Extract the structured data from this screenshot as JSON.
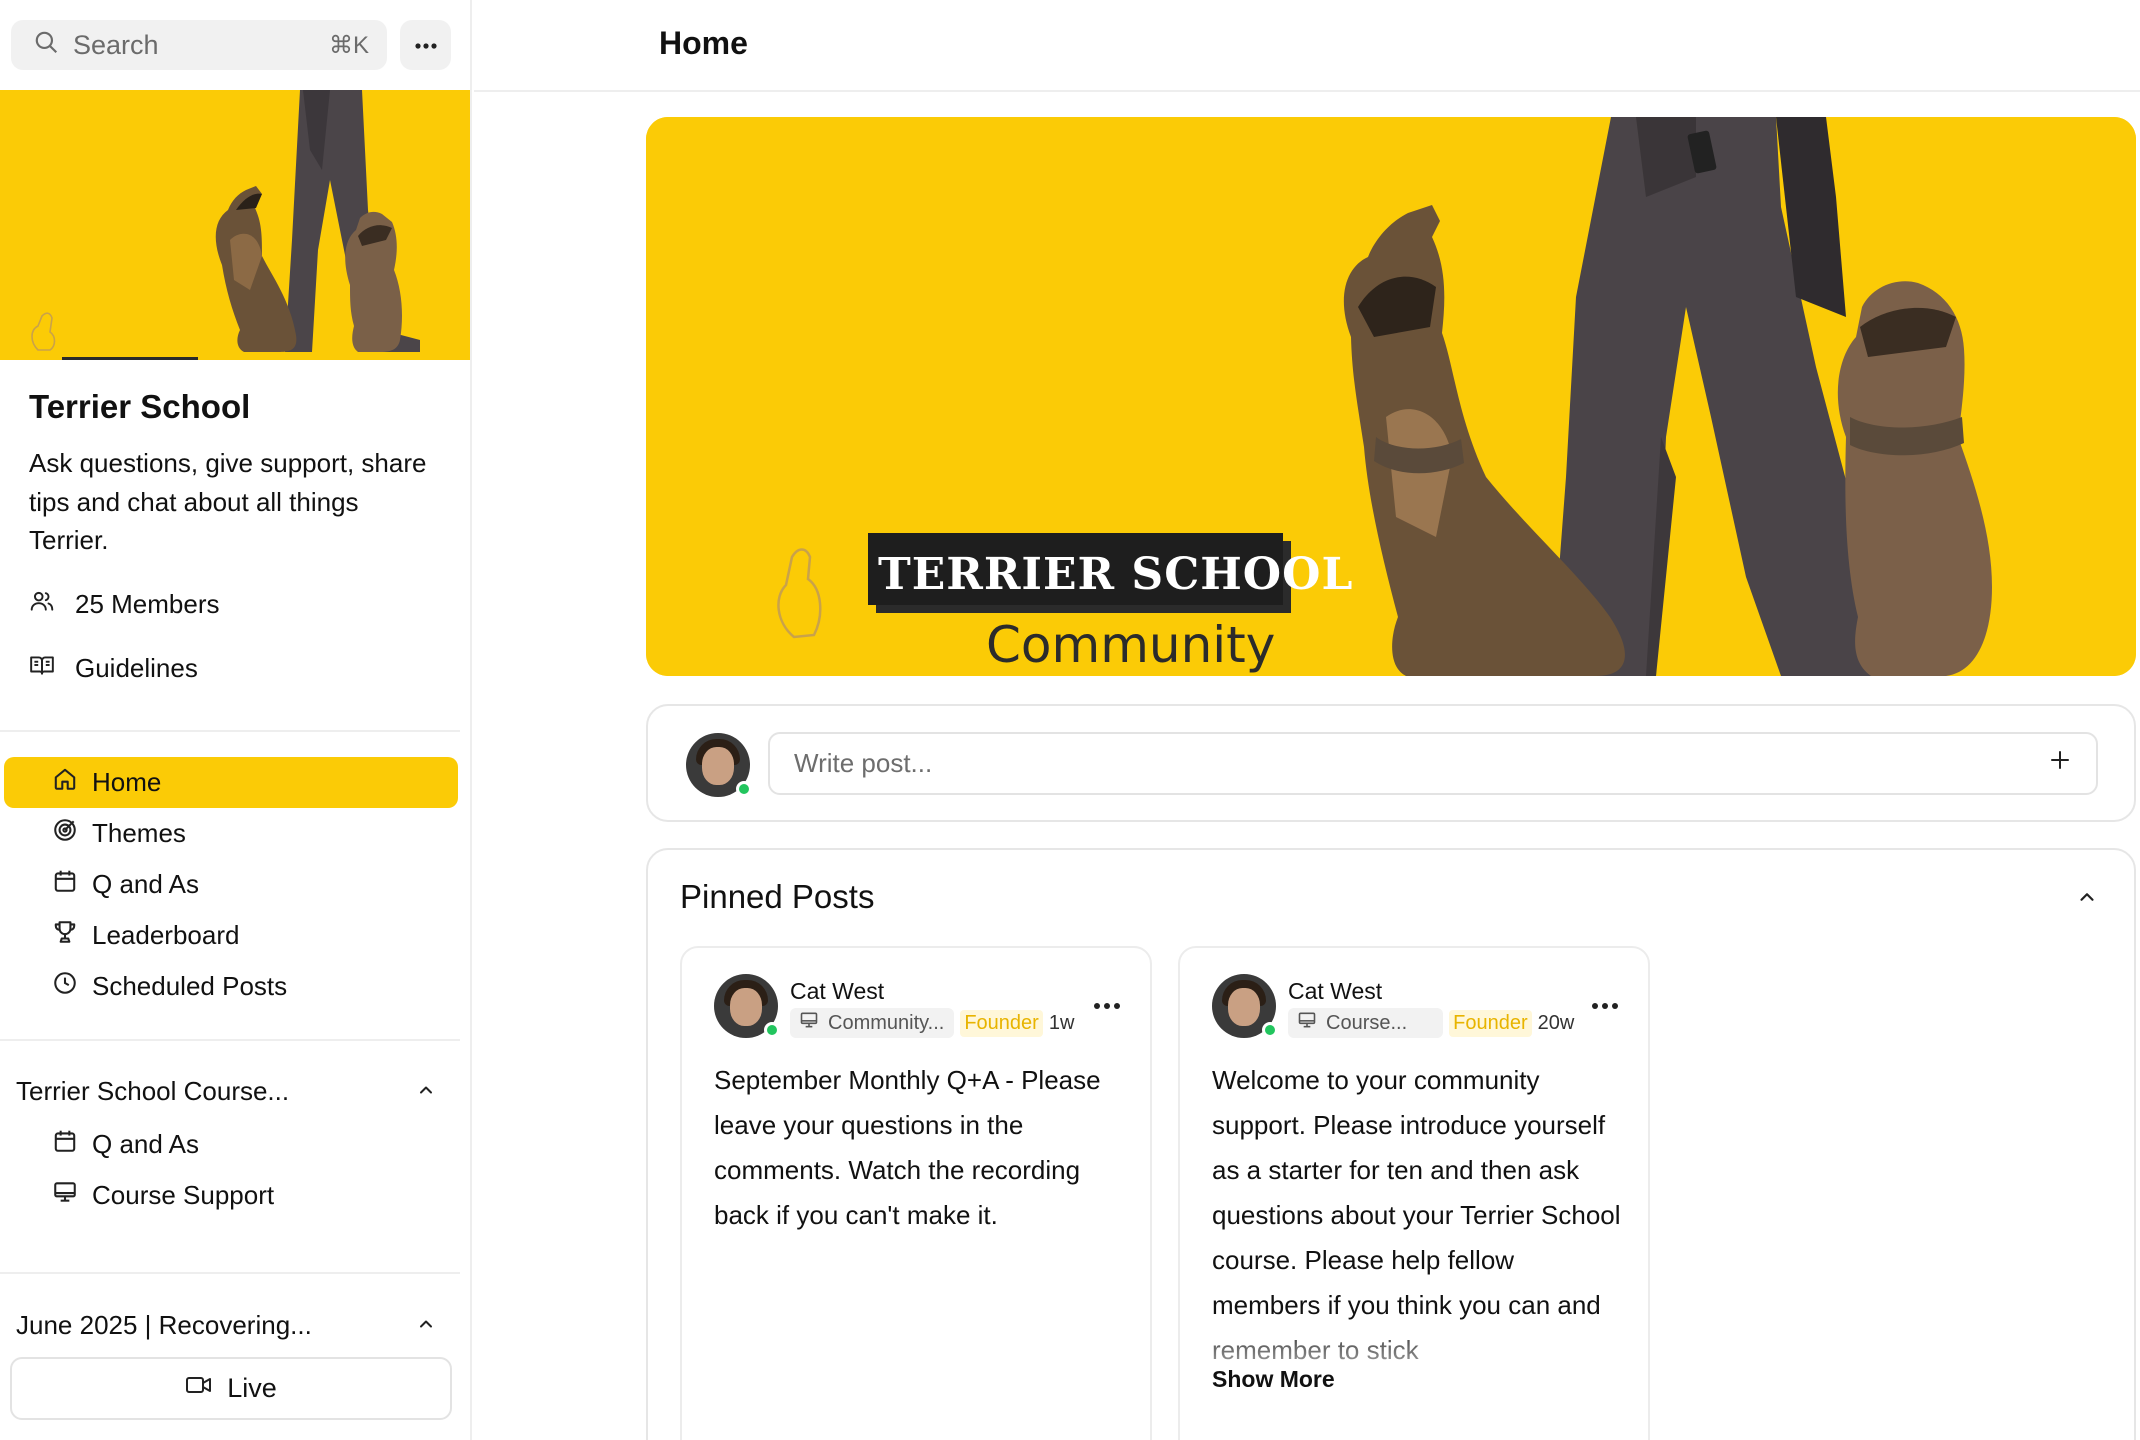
{
  "search": {
    "label": "Search",
    "shortcut": "⌘K"
  },
  "community": {
    "name": "Terrier School",
    "description": "Ask questions, give support, share tips and chat about all things Terrier.",
    "members": "25 Members",
    "guidelines": "Guidelines",
    "banner": {
      "brand": "TERRIER SCHOOL",
      "sub": "Community"
    }
  },
  "nav": {
    "items": [
      {
        "label": "Home",
        "icon": "home-icon",
        "active": true
      },
      {
        "label": "Themes",
        "icon": "target-icon"
      },
      {
        "label": "Q and As",
        "icon": "calendar-icon"
      },
      {
        "label": "Leaderboard",
        "icon": "trophy-icon"
      },
      {
        "label": "Scheduled Posts",
        "icon": "clock-icon"
      }
    ],
    "groups": [
      {
        "title": "Terrier School Course...",
        "items": [
          {
            "label": "Q and As",
            "icon": "calendar-icon"
          },
          {
            "label": "Course Support",
            "icon": "monitor-icon"
          }
        ]
      },
      {
        "title": "June 2025 | Recovering..."
      }
    ],
    "live_label": "Live"
  },
  "header": {
    "title": "Home"
  },
  "composer": {
    "placeholder": "Write post..."
  },
  "pinned": {
    "title": "Pinned Posts",
    "posts": [
      {
        "author": "Cat West",
        "space": "Community...",
        "role": "Founder",
        "time": "1w",
        "body": "September Monthly Q+A - Please leave your questions in the comments. Watch the recording back if you can't make it."
      },
      {
        "author": "Cat West",
        "space": "Course...",
        "role": "Founder",
        "time": "20w",
        "body": "Welcome to your community support. Please introduce yourself as a starter for ten and then ask questions about your Terrier School course. Please help fellow members if you think you can and remember to stick",
        "show_more": "Show More"
      }
    ]
  },
  "colors": {
    "accent": "#fbcb06",
    "online": "#22c55e",
    "founder": "#e8b400"
  }
}
